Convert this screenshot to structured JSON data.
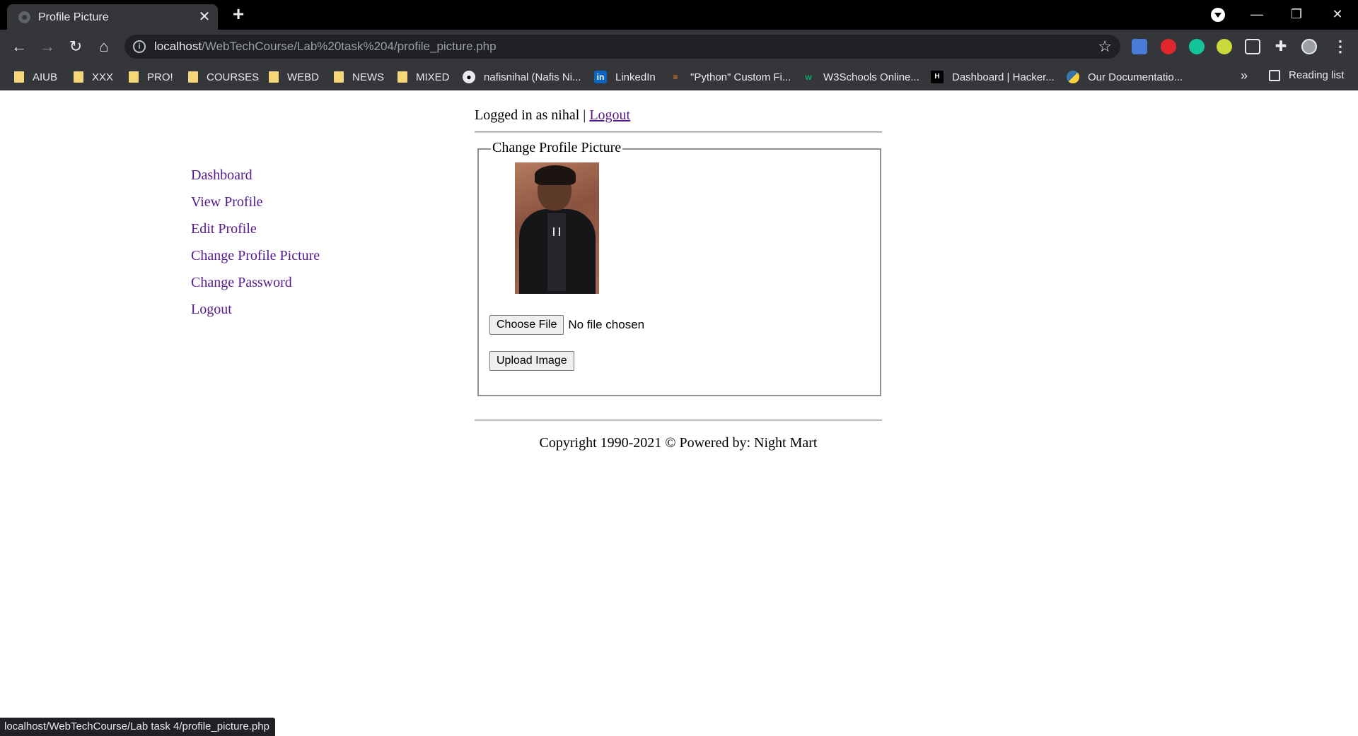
{
  "browser": {
    "tab_title": "Profile Picture",
    "tab_close": "✕",
    "new_tab": "+",
    "url_host": "localhost",
    "url_path": "/WebTechCourse/Lab%20task%204/profile_picture.php",
    "window_controls": {
      "minimize": "—",
      "restore": "❐",
      "close": "✕"
    },
    "nav": {
      "back": "←",
      "forward": "→",
      "reload": "↻",
      "home": "⌂"
    },
    "bookmarks": [
      {
        "label": "AIUB",
        "icon": "folder-icon"
      },
      {
        "label": "XXX",
        "icon": "folder-icon"
      },
      {
        "label": "PRO!",
        "icon": "folder-icon"
      },
      {
        "label": "COURSES",
        "icon": "folder-icon"
      },
      {
        "label": "WEBD",
        "icon": "folder-icon"
      },
      {
        "label": "NEWS",
        "icon": "folder-icon"
      },
      {
        "label": "MIXED",
        "icon": "folder-icon"
      },
      {
        "label": "nafisnihal (Nafis Ni...",
        "icon": "github-icon"
      },
      {
        "label": "LinkedIn",
        "icon": "linkedin-icon"
      },
      {
        "label": "\"Python\" Custom Fi...",
        "icon": "stackoverflow-icon"
      },
      {
        "label": "W3Schools Online...",
        "icon": "w3schools-icon"
      },
      {
        "label": "Dashboard | Hacker...",
        "icon": "hackerrank-icon"
      },
      {
        "label": "Our Documentatio...",
        "icon": "python-icon"
      }
    ],
    "bookmarks_overflow": "»",
    "reading_list": "Reading list",
    "status_url": "localhost/WebTechCourse/Lab task 4/profile_picture.php"
  },
  "page": {
    "logged_in_text": "Logged in as nihal |",
    "logout_link": "Logout",
    "sidebar": [
      "Dashboard",
      "View Profile",
      "Edit Profile",
      "Change Profile Picture",
      "Change Password",
      "Logout"
    ],
    "legend": "Change Profile Picture",
    "choose_file": "Choose File",
    "no_file": "No file chosen",
    "upload_button": "Upload Image",
    "footer": "Copyright 1990-2021 © Powered by: Night Mart"
  },
  "colors": {
    "link": "#551a8b",
    "chrome_dark": "#35363a",
    "tab_strip": "#000000"
  }
}
